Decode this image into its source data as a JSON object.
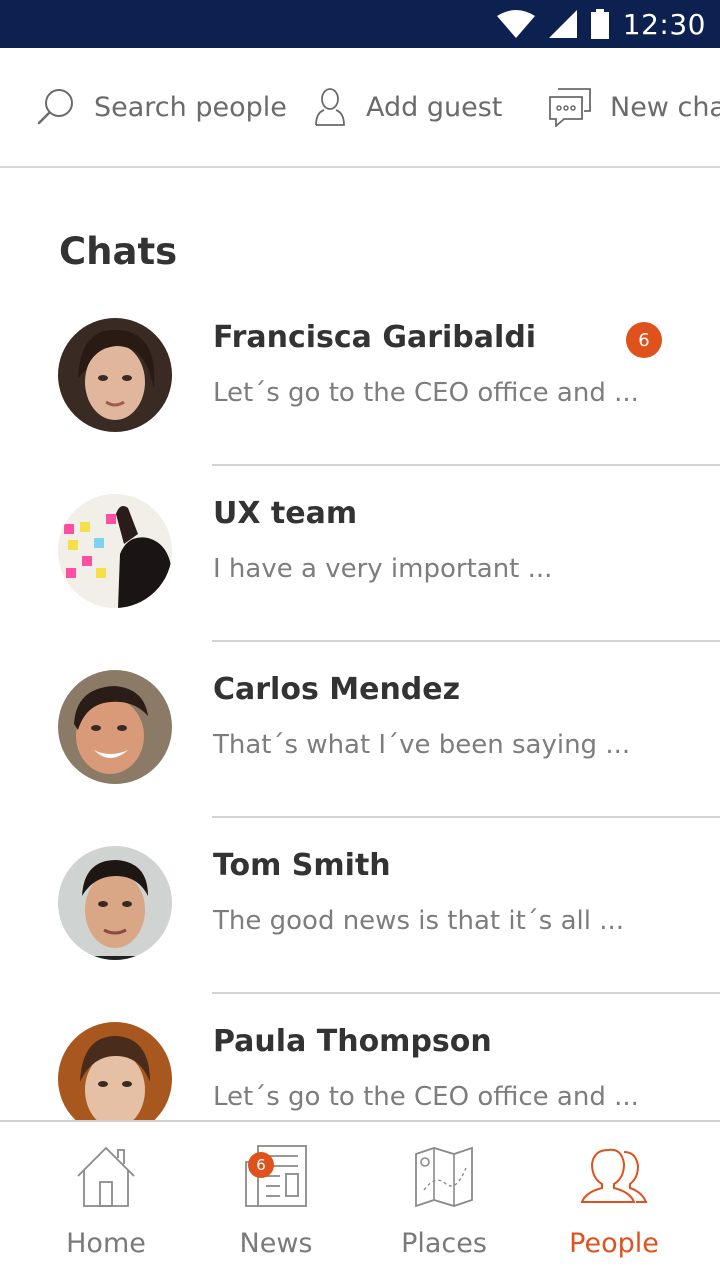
{
  "status_bar": {
    "time": "12:30"
  },
  "toolbar": {
    "search_label": "Search people",
    "add_guest_label": "Add guest",
    "new_chat_label": "New chat"
  },
  "section_title": "Chats",
  "chats": [
    {
      "name": "Francisca Garibaldi",
      "preview": "Let´s go to the CEO office and ...",
      "unread": "6"
    },
    {
      "name": "UX team",
      "preview": "I have a very important ..."
    },
    {
      "name": "Carlos Mendez",
      "preview": "That´s what I´ve been saying ..."
    },
    {
      "name": "Tom Smith",
      "preview": "The good news is that it´s all ..."
    },
    {
      "name": "Paula Thompson",
      "preview": "Let´s go to the CEO office and ..."
    }
  ],
  "bottom_nav": {
    "items": [
      {
        "label": "Home",
        "icon": "home-icon"
      },
      {
        "label": "News",
        "icon": "news-icon",
        "badge": "6"
      },
      {
        "label": "Places",
        "icon": "map-icon"
      },
      {
        "label": "People",
        "icon": "people-icon",
        "active": true
      }
    ]
  },
  "colors": {
    "status_bar": "#0d2150",
    "accent": "#e0521c",
    "text_dark": "#333333",
    "text_muted": "#7d7d7d"
  }
}
